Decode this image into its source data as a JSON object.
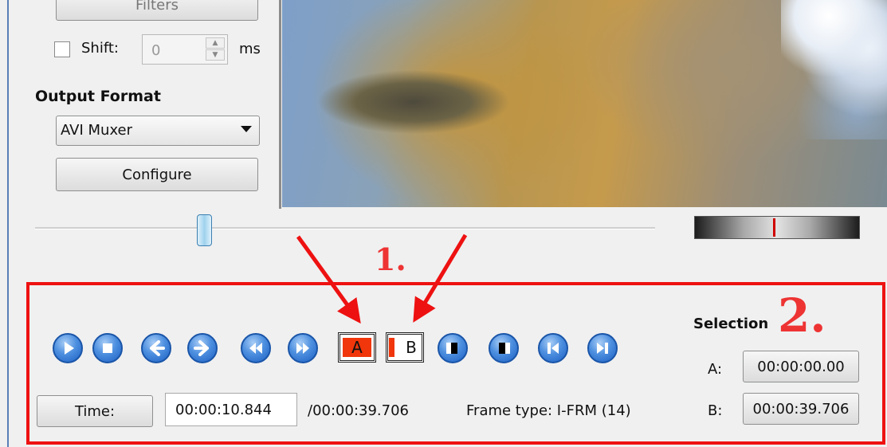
{
  "left_panel": {
    "filters_label": "Filters",
    "shift_label": "Shift:",
    "shift_checked": false,
    "shift_value": "0",
    "shift_unit": "ms",
    "output_format_heading": "Output Format",
    "output_format_selected": "AVI Muxer",
    "configure_label": "Configure"
  },
  "timeline": {
    "position_fraction": 0.273
  },
  "annotations": {
    "label_1": "1.",
    "label_2": "2.",
    "color": "#ee1111"
  },
  "transport": {
    "buttons": [
      "play-icon",
      "stop-icon",
      "previous-frame-icon",
      "next-frame-icon",
      "rewind-icon",
      "fast-forward-icon",
      "mark-a-icon",
      "mark-b-icon",
      "go-to-mark-a-icon",
      "go-to-mark-b-icon",
      "previous-keyframe-icon",
      "next-keyframe-icon"
    ],
    "mark_a_label": "A",
    "mark_b_label": "B",
    "marker_color": "#f0360a",
    "button_color": "#2f74d0"
  },
  "time": {
    "button_label": "Time:",
    "current_time": "00:00:10.844",
    "total_duration": "/00:00:39.706",
    "frame_type": "Frame type:  I-FRM (14)"
  },
  "selection": {
    "heading": "Selection",
    "a_label": "A:",
    "a_value": "00:00:00.00",
    "b_label": "B:",
    "b_value": "00:00:39.706"
  }
}
